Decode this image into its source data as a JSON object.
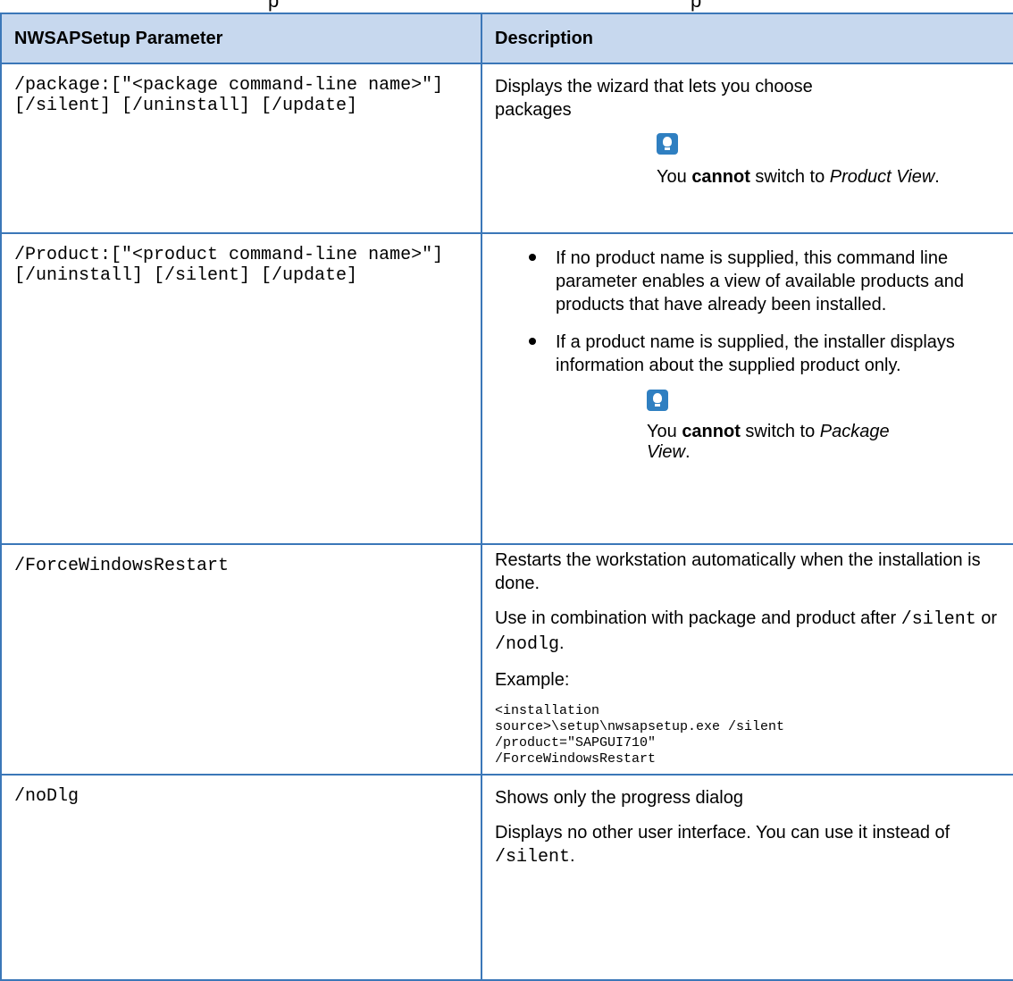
{
  "top_fragments": [
    "p",
    "p"
  ],
  "table": {
    "headers": [
      "NWSAPSetup Parameter",
      "Description"
    ],
    "rows": [
      {
        "param": "/package:[\"<package command-line name>\"] [/silent] [/uninstall] [/update]",
        "desc_text": "Displays the wizard that lets you choose packages",
        "tip_pre": "You ",
        "tip_bold": "cannot",
        "tip_mid": " switch to ",
        "tip_italic": "Product View",
        "tip_end": "."
      },
      {
        "param": "/Product:[\"<product command-line name>\"] [/uninstall] [/silent] [/update]",
        "bullet1": "If no product name is supplied, this command line parameter enables a view of  available products and products that have already been installed.",
        "bullet2": "If a product name is supplied, the installer displays information about the supplied product only.",
        "tip_pre": "You ",
        "tip_bold": "cannot",
        "tip_mid": " switch to ",
        "tip_italic": "Package View",
        "tip_end": "."
      },
      {
        "param": "/ForceWindowsRestart",
        "desc1": "Restarts the workstation automatically when the installation is done.",
        "desc2_pre": "Use in combination with package and product after ",
        "desc2_code1": "/silent",
        "desc2_mid": " or ",
        "desc2_code2": "/nodlg",
        "desc2_end": ".",
        "example_label": "Example:",
        "example_code": "<installation\nsource>\\setup\\nwsapsetup.exe /silent\n/product=\"SAPGUI710\"\n/ForceWindowsRestart"
      },
      {
        "param": "/noDlg",
        "desc1": "Shows only the progress dialog",
        "desc2_pre": "Displays no other user interface. You can use it instead of ",
        "desc2_code": "/silent",
        "desc2_end": "."
      }
    ]
  },
  "icons": {
    "tip": "lightbulb-tip-icon",
    "bullet": "bullet-dot-icon"
  },
  "colors": {
    "border": "#3b77b8",
    "header_bg": "#c7d8ee",
    "tip_icon": "#2f7fc1"
  }
}
